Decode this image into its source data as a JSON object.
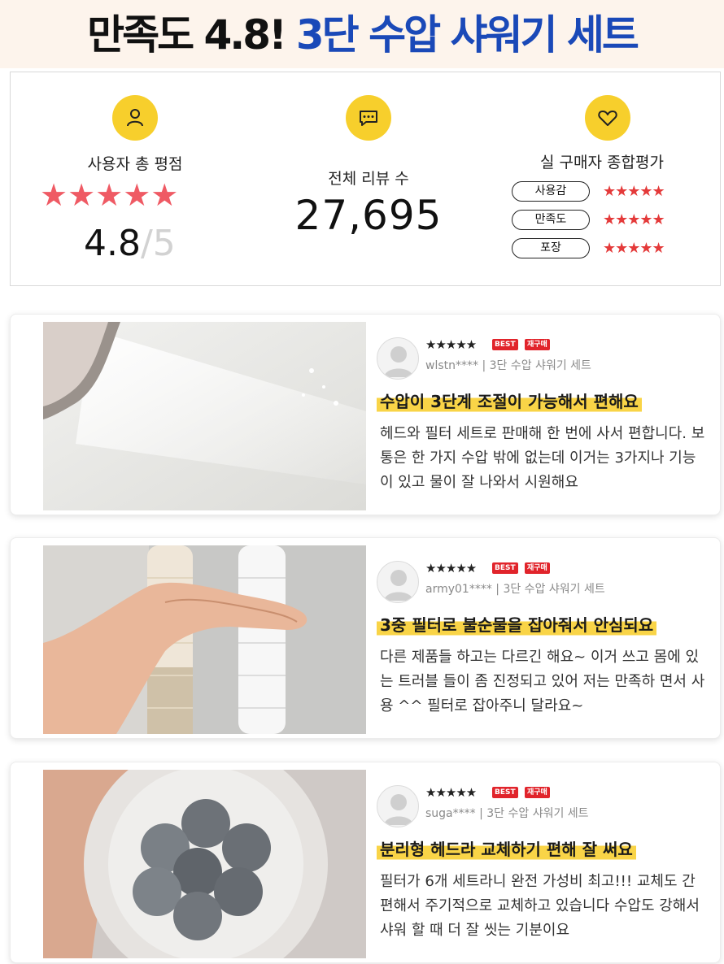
{
  "banner": {
    "title_black": "만족도 4.8!",
    "title_blue": "3단 수압 샤워기 세트"
  },
  "summary": {
    "user_rating": {
      "icon": "user-icon",
      "label": "사용자 총 평점",
      "stars": "★★★★★",
      "score": "4.8",
      "out_of": "/5"
    },
    "total_reviews": {
      "icon": "chat-icon",
      "label": "전체 리뷰 수",
      "count": "27,695"
    },
    "buyer_eval": {
      "icon": "heart-icon",
      "label": "실 구매자 종합평가",
      "rows": [
        {
          "label": "사용감",
          "stars": "★★★★★"
        },
        {
          "label": "만족도",
          "stars": "★★★★★"
        },
        {
          "label": "포장",
          "stars": "★★★★★"
        }
      ]
    }
  },
  "reviews": [
    {
      "stars": "★★★★★",
      "best": "BEST",
      "repurchase": "재구매",
      "user": "wlstn**** | 3단 수압 샤워기 세트",
      "headline": "수압이 3단계 조절이 가능해서 편해요",
      "body": "헤드와 필터 세트로 판매해 한 번에 사서 편합니다. 보통은 한 가지 수압 밖에 없는데 이거는 3가지나 기능이 있고 물이 잘 나와서 시원해요"
    },
    {
      "stars": "★★★★★",
      "best": "BEST",
      "repurchase": "재구매",
      "user": "army01**** | 3단 수압 샤워기 세트",
      "headline": "3중 필터로 불순물을 잡아줘서 안심되요",
      "body": "다른 제품들 하고는 다르긴 해요~ 이거 쓰고 몸에 있는 트러블 들이 좀 진정되고 있어 저는 만족하 면서 사용 ^^ 필터로 잡아주니 달라요~"
    },
    {
      "stars": "★★★★★",
      "best": "BEST",
      "repurchase": "재구매",
      "user": "suga**** | 3단 수압 샤워기 세트",
      "headline": "분리형 헤드라 교체하기 편해 잘 써요",
      "body": "필터가 6개 세트라니 완전 가성비 최고!!! 교체도 간편해서 주기적으로 교체하고 있습니다 수압도 강해서 샤워 할 때 더 잘 씻는 기분이요"
    }
  ],
  "colors": {
    "accent_yellow": "#f7cf2c",
    "star_red": "#ef5a64",
    "title_blue": "#1a49b8",
    "tag_red": "#e1242b"
  }
}
